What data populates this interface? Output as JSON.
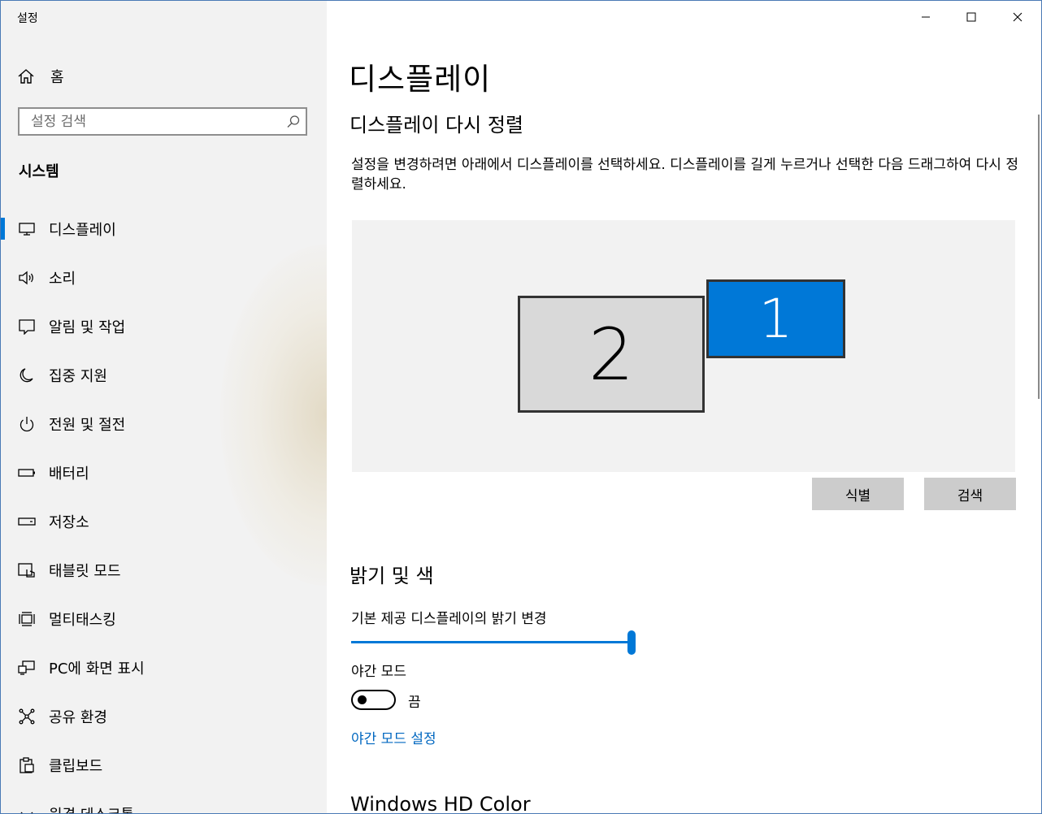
{
  "window": {
    "title": "설정",
    "controls": [
      "minimize",
      "maximize",
      "close"
    ]
  },
  "sidebar": {
    "home_label": "홈",
    "search_placeholder": "설정 검색",
    "section_title": "시스템",
    "items": [
      {
        "label": "디스플레이",
        "icon": "monitor-icon",
        "selected": true
      },
      {
        "label": "소리",
        "icon": "speaker-icon",
        "selected": false
      },
      {
        "label": "알림 및 작업",
        "icon": "message-icon",
        "selected": false
      },
      {
        "label": "집중 지원",
        "icon": "moon-icon",
        "selected": false
      },
      {
        "label": "전원 및 절전",
        "icon": "power-icon",
        "selected": false
      },
      {
        "label": "배터리",
        "icon": "battery-icon",
        "selected": false
      },
      {
        "label": "저장소",
        "icon": "storage-icon",
        "selected": false
      },
      {
        "label": "태블릿 모드",
        "icon": "tablet-icon",
        "selected": false
      },
      {
        "label": "멀티태스킹",
        "icon": "multitask-icon",
        "selected": false
      },
      {
        "label": "PC에 화면 표시",
        "icon": "project-icon",
        "selected": false
      },
      {
        "label": "공유 환경",
        "icon": "share-icon",
        "selected": false
      },
      {
        "label": "클립보드",
        "icon": "clipboard-icon",
        "selected": false
      },
      {
        "label": "원격 데스크톱",
        "icon": "remote-icon",
        "selected": false
      }
    ]
  },
  "main": {
    "page_title": "디스플레이",
    "rearrange": {
      "heading": "디스플레이 다시 정렬",
      "description": "설정을 변경하려면 아래에서 디스플레이를 선택하세요. 디스플레이를 길게 누르거나 선택한 다음 드래그하여 다시 정렬하세요.",
      "monitors": [
        {
          "number": "2",
          "selected": false
        },
        {
          "number": "1",
          "selected": true
        }
      ],
      "identify_button": "식별",
      "detect_button": "검색"
    },
    "brightness": {
      "heading": "밝기 및 색",
      "slider_label": "기본 제공 디스플레이의 밝기 변경",
      "slider_value_percent": 100,
      "night_light_label": "야간 모드",
      "night_light_state": "끔",
      "night_light_on": false,
      "night_light_settings_link": "야간 모드 설정"
    },
    "hd_color_heading": "Windows HD Color"
  },
  "colors": {
    "accent": "#0078d7",
    "link": "#0067c0",
    "sidebar_bg": "#f2f2f2",
    "arrange_bg": "#f2f2f2",
    "button_bg": "#cccccc"
  }
}
